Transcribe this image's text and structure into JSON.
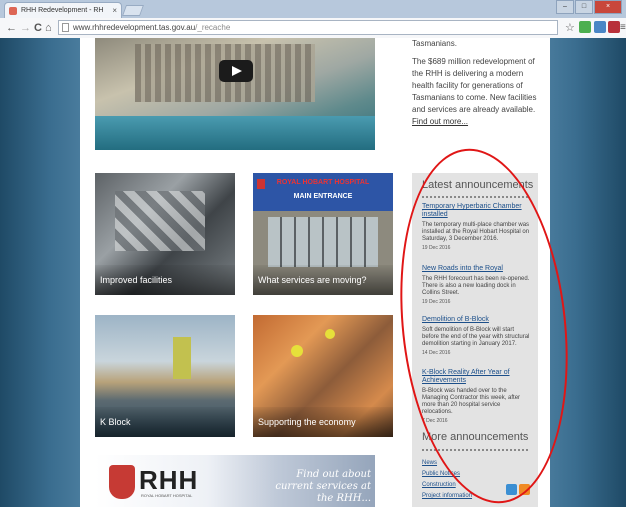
{
  "browser": {
    "tab_title": "RHH Redevelopment - RH",
    "tab_close": "×",
    "url_host": "www.rhhredevelopment.tas.gov.au",
    "url_path": "/_recache",
    "nav_back": "←",
    "nav_forward": "→",
    "reload": "C",
    "home": "⌂",
    "star": "☆",
    "menu": "≡"
  },
  "intro": {
    "line1": "Tasmanians.",
    "paragraph": "The $689 million redevelopment of the RHH is delivering a modern health facility for generations of Tasmanians to come. New facilities and services are already available.",
    "link": "Find out more..."
  },
  "tiles": [
    {
      "caption": "Improved facilities"
    },
    {
      "caption": "What services are moving?",
      "sign_top": "ROYAL HOBART HOSPITAL",
      "sign_bottom": "MAIN ENTRANCE"
    },
    {
      "caption": "K Block"
    },
    {
      "caption": "Supporting the economy"
    }
  ],
  "banner": {
    "logo_text": "RHH",
    "logo_sub": "ROYAL HOBART HOSPITAL",
    "tagline": "Find out about current services at the RHH..."
  },
  "sidebar": {
    "latest_title": "Latest announcements",
    "announcements": [
      {
        "title": "Temporary Hyperbaric Chamber installed",
        "body": "The temporary multi-place chamber was installed at the Royal Hobart Hospital on Saturday, 3 December 2016.",
        "date": "19 Dec 2016"
      },
      {
        "title": "New Roads into the Royal",
        "body": "The RHH forecourt has been re-opened. There is also a new loading dock in Collins Street.",
        "date": "19 Dec 2016"
      },
      {
        "title": "Demolition of B-Block",
        "body": "Soft demolition of B-Block will start before the end of the year with structural demolition starting in January 2017.",
        "date": "14 Dec 2016"
      },
      {
        "title": "K-Block Reality After Year of Achievements",
        "body": "B-Block was handed over to the Managing Contractor this week, after more than 20 hospital service relocations.",
        "date": "7 Dec 2016"
      }
    ],
    "more_title": "More announcements",
    "more_links": [
      "News",
      "Public Notices",
      "Construction",
      "Project information"
    ]
  },
  "colors": {
    "link": "#1c4f8a",
    "annotation_ellipse": "#e01616"
  }
}
